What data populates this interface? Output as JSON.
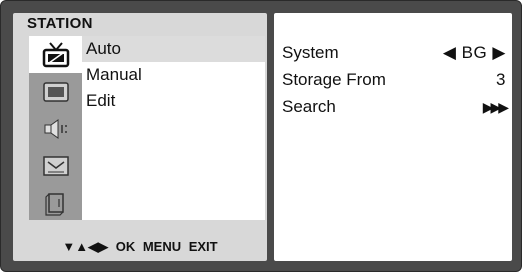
{
  "panel_title": "STATION",
  "icons": [
    "antenna-tv-icon",
    "screen-icon",
    "speaker-icon",
    "clock-icon",
    "card-icon"
  ],
  "menu": {
    "items": [
      {
        "label": "Auto"
      },
      {
        "label": "Manual"
      },
      {
        "label": "Edit"
      }
    ],
    "selected_label": "Auto"
  },
  "hint_bar": "▼▲◀▶ OK MENU EXIT",
  "settings": [
    {
      "label": "System",
      "value": "◀ BG ▶"
    },
    {
      "label": "Storage From",
      "value": "3"
    },
    {
      "label": "Search",
      "value": "▶▶▶"
    }
  ],
  "colors": {
    "frame": "#4a4a4a",
    "left_panel": "#d8d8d8",
    "icon_column": "#9a9a9a",
    "highlight": "#dcdcdc"
  }
}
